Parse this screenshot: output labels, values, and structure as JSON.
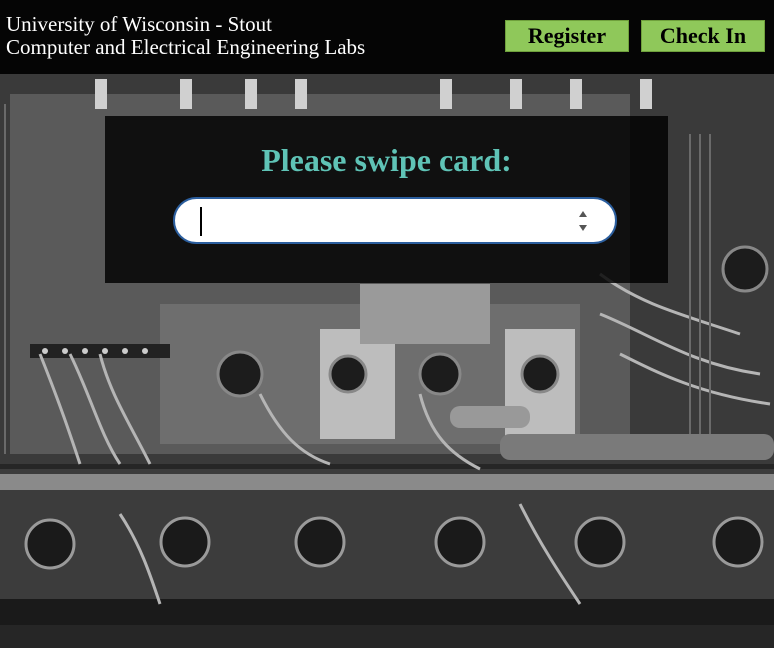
{
  "header": {
    "title_line1": "University of Wisconsin - Stout",
    "title_line2": "Computer and Electrical Engineering Labs",
    "register_label": "Register",
    "checkin_label": "Check In"
  },
  "panel": {
    "prompt": "Please swipe card:",
    "card_input": {
      "value": "",
      "placeholder": ""
    }
  },
  "colors": {
    "header_bg": "#050505",
    "button_green": "#8fc85a",
    "prompt_teal": "#5fc3b6",
    "input_border": "#2b5e9e"
  },
  "icons": [
    "spinner-up-icon",
    "spinner-down-icon"
  ]
}
